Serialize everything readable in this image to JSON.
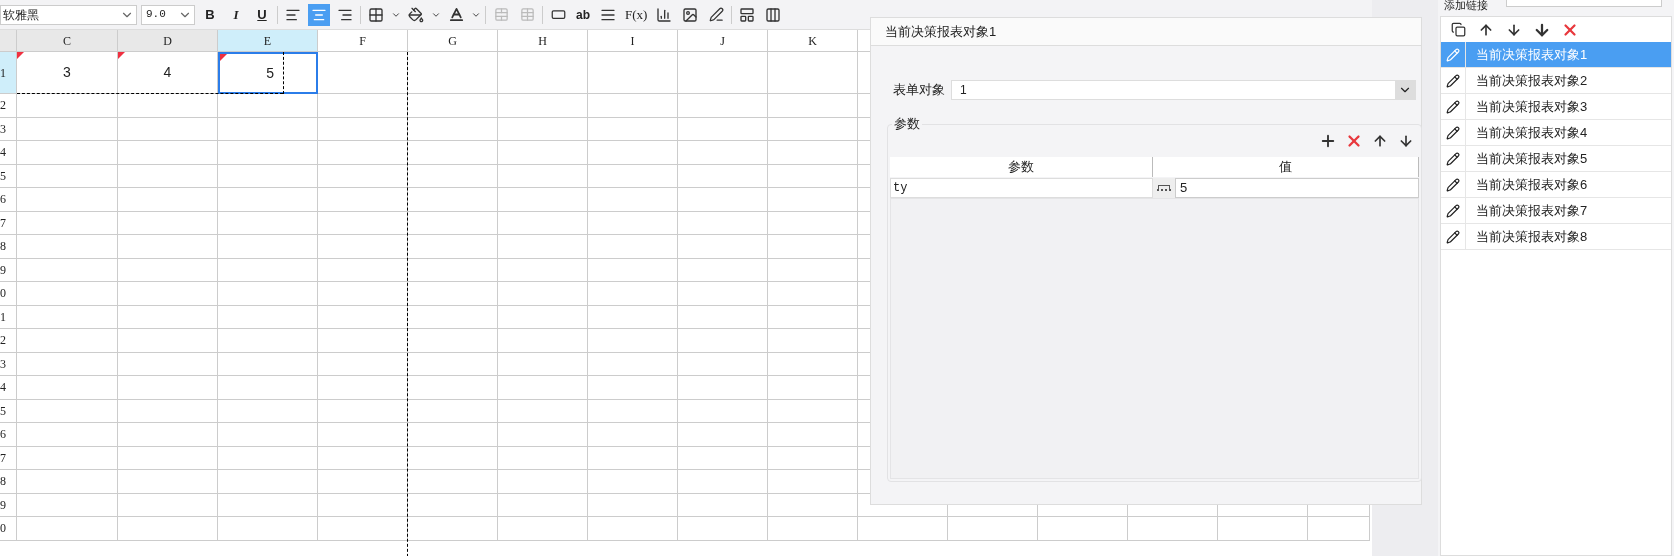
{
  "toolbar": {
    "font": "软雅黑",
    "font_size": "9.0",
    "style_buttons": [
      "B",
      "I",
      "U"
    ],
    "align": [
      {
        "selected": false
      },
      {
        "selected": true
      },
      {
        "selected": false
      }
    ],
    "text_buttons": [
      "ab",
      "F(x)"
    ]
  },
  "sheet": {
    "columns": [
      {
        "label": "C",
        "selected": false
      },
      {
        "label": "D",
        "selected": false
      },
      {
        "label": "E",
        "selected": true
      },
      {
        "label": "F",
        "selected": false
      },
      {
        "label": "G",
        "selected": false
      },
      {
        "label": "H",
        "selected": false
      },
      {
        "label": "I",
        "selected": false
      },
      {
        "label": "J",
        "selected": false
      },
      {
        "label": "K",
        "selected": false
      }
    ],
    "rows": [
      {
        "label": "1",
        "selected": true,
        "cells": [
          {
            "value": "3",
            "flagged": true,
            "selected": false
          },
          {
            "value": "4",
            "flagged": true,
            "selected": false
          },
          {
            "value": "5",
            "flagged": true,
            "selected": true
          }
        ]
      },
      {
        "label": "2",
        "selected": false
      },
      {
        "label": "3",
        "selected": false
      },
      {
        "label": "4",
        "selected": false
      },
      {
        "label": "5",
        "selected": false
      },
      {
        "label": "6",
        "selected": false
      },
      {
        "label": "7",
        "selected": false
      },
      {
        "label": "8",
        "selected": false
      },
      {
        "label": "9",
        "selected": false
      },
      {
        "label": "0",
        "selected": false
      },
      {
        "label": "1",
        "selected": false
      },
      {
        "label": "2",
        "selected": false
      },
      {
        "label": "3",
        "selected": false
      },
      {
        "label": "4",
        "selected": false
      },
      {
        "label": "5",
        "selected": false
      },
      {
        "label": "6",
        "selected": false
      },
      {
        "label": "7",
        "selected": false
      },
      {
        "label": "8",
        "selected": false
      },
      {
        "label": "9",
        "selected": false
      },
      {
        "label": "0",
        "selected": false
      }
    ]
  },
  "dialog": {
    "tab": "当前决策报表对象1",
    "form_label": "表单对象",
    "form_value": "1",
    "group_title": "参数",
    "columns": [
      "参数",
      "值"
    ],
    "params": [
      {
        "name": "ty",
        "value": "5"
      }
    ]
  },
  "right_panel": {
    "link_label": "添加链接",
    "items": [
      {
        "label": "当前决策报表对象1",
        "selected": true
      },
      {
        "label": "当前决策报表对象2",
        "selected": false
      },
      {
        "label": "当前决策报表对象3",
        "selected": false
      },
      {
        "label": "当前决策报表对象4",
        "selected": false
      },
      {
        "label": "当前决策报表对象5",
        "selected": false
      },
      {
        "label": "当前决策报表对象6",
        "selected": false
      },
      {
        "label": "当前决策报表对象7",
        "selected": false
      },
      {
        "label": "当前决策报表对象8",
        "selected": false
      }
    ]
  }
}
